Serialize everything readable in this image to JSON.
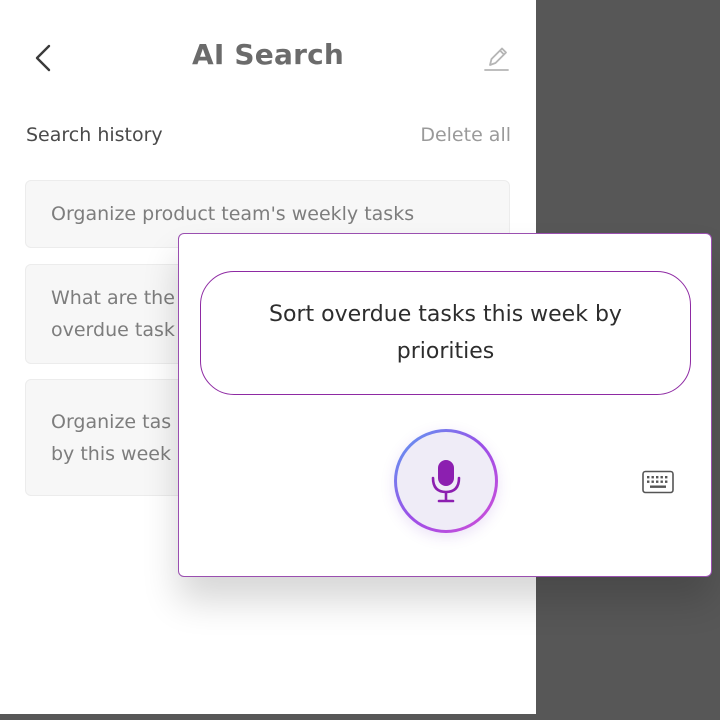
{
  "header": {
    "title": "AI Search",
    "back_icon": "chevron-left-icon",
    "edit_icon": "pencil-icon"
  },
  "history": {
    "label": "Search history",
    "delete_all": "Delete all",
    "items": [
      {
        "text": "Organize product team's weekly tasks"
      },
      {
        "text": "What are the\noverdue task"
      },
      {
        "text": "Organize tas\nby this week"
      }
    ]
  },
  "voice": {
    "query": "Sort overdue tasks this week by priorities",
    "mic_icon": "microphone-icon",
    "keyboard_icon": "keyboard-icon"
  },
  "colors": {
    "accent": "#8e2aa3",
    "mic_purple": "#8c1fb0",
    "backdrop": "#575757"
  }
}
